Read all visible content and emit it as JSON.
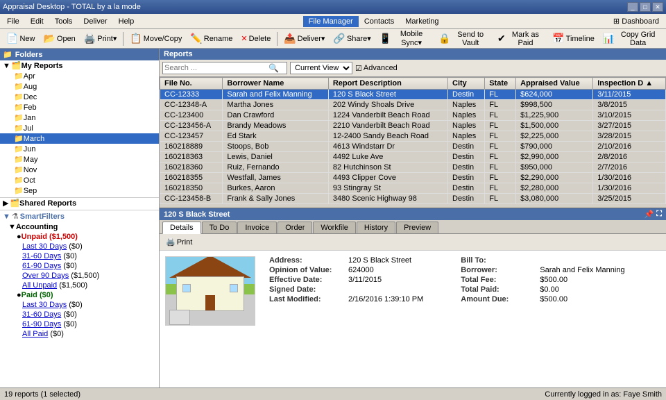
{
  "titleBar": {
    "title": "Appraisal Desktop - TOTAL by a la mode",
    "controls": [
      "_",
      "□",
      "✕"
    ]
  },
  "menuBar": {
    "items": [
      "File",
      "Edit",
      "Tools",
      "Deliver",
      "Help",
      "File Manager",
      "Contacts",
      "Marketing"
    ],
    "active": "File Manager"
  },
  "toolbar": {
    "buttons": [
      {
        "label": "New",
        "icon": "📄"
      },
      {
        "label": "Open",
        "icon": "📂"
      },
      {
        "label": "Print",
        "icon": "🖨️"
      },
      {
        "label": "Move/Copy",
        "icon": "📋"
      },
      {
        "label": "Rename",
        "icon": "✏️"
      },
      {
        "label": "Delete",
        "icon": "✕"
      },
      {
        "label": "Deliver",
        "icon": "📤"
      },
      {
        "label": "Share",
        "icon": "🔗"
      },
      {
        "label": "Mobile Sync",
        "icon": "📱"
      },
      {
        "label": "Send to Vault",
        "icon": "🔒"
      },
      {
        "label": "Mark as Paid",
        "icon": "✔"
      },
      {
        "label": "Timeline",
        "icon": "📅"
      },
      {
        "label": "Copy Grid Data",
        "icon": "📊"
      }
    ],
    "dashboard_label": "Dashboard"
  },
  "sidebar": {
    "header": "Folders",
    "myReports": {
      "label": "My Reports",
      "items": [
        "Apr",
        "Aug",
        "Dec",
        "Feb",
        "Jan",
        "Jul",
        "March",
        "Jun",
        "May",
        "Nov",
        "Oct",
        "Sep"
      ]
    },
    "sharedReports": {
      "label": "Shared Reports"
    },
    "smartFilters": {
      "label": "SmartFilters",
      "accounting": {
        "label": "Accounting",
        "groups": [
          {
            "name": "Unpaid",
            "amount": "($1,500)",
            "items": [
              {
                "label": "Last 30 Days",
                "amount": "($0)"
              },
              {
                "label": "31-60 Days",
                "amount": "($0)"
              },
              {
                "label": "61-90 Days",
                "amount": "($0)"
              },
              {
                "label": "Over 90 Days",
                "amount": "($1,500)"
              },
              {
                "label": "All Unpaid",
                "amount": "($1,500)"
              }
            ]
          },
          {
            "name": "Paid",
            "amount": "($0)",
            "items": [
              {
                "label": "Last 30 Days",
                "amount": "($0)"
              },
              {
                "label": "31-60 Days",
                "amount": "($0)"
              },
              {
                "label": "61-90 Days",
                "amount": "($0)"
              },
              {
                "label": "All Paid",
                "amount": "($0)"
              }
            ]
          }
        ]
      }
    }
  },
  "reports": {
    "header": "Reports",
    "search": {
      "placeholder": "Search ...",
      "view": "Current View",
      "advanced": "Advanced"
    },
    "columns": [
      "File No.",
      "Borrower Name",
      "Report Description",
      "City",
      "State",
      "Appraised Value",
      "Inspection D ▲"
    ],
    "rows": [
      {
        "fileNo": "CC-12333",
        "borrower": "Sarah and Felix Manning",
        "description": "120 S Black Street",
        "city": "Destin",
        "state": "FL",
        "value": "$624,000",
        "date": "3/11/2015",
        "selected": true
      },
      {
        "fileNo": "CC-12348-A",
        "borrower": "Martha Jones",
        "description": "202 Windy Shoals Drive",
        "city": "Naples",
        "state": "FL",
        "value": "$998,500",
        "date": "3/8/2015"
      },
      {
        "fileNo": "CC-123400",
        "borrower": "Dan Crawford",
        "description": "1224 Vanderbilt Beach Road",
        "city": "Naples",
        "state": "FL",
        "value": "$1,225,900",
        "date": "3/10/2015"
      },
      {
        "fileNo": "CC-123456-A",
        "borrower": "Brandy Meadows",
        "description": "2210 Vanderbilt Beach Road",
        "city": "Naples",
        "state": "FL",
        "value": "$1,500,000",
        "date": "3/27/2015"
      },
      {
        "fileNo": "CC-123457",
        "borrower": "Ed Stark",
        "description": "12-2400 Sandy Beach Road",
        "city": "Naples",
        "state": "FL",
        "value": "$2,225,000",
        "date": "3/28/2015"
      },
      {
        "fileNo": "160218889",
        "borrower": "Stoops, Bob",
        "description": "4613 Windstarr Dr",
        "city": "Destin",
        "state": "FL",
        "value": "$790,000",
        "date": "2/10/2016"
      },
      {
        "fileNo": "160218363",
        "borrower": "Lewis, Daniel",
        "description": "4492 Luke Ave",
        "city": "Destin",
        "state": "FL",
        "value": "$2,990,000",
        "date": "2/8/2016"
      },
      {
        "fileNo": "160218360",
        "borrower": "Ruiz, Fernando",
        "description": "82 Hutchinson St",
        "city": "Destin",
        "state": "FL",
        "value": "$950,000",
        "date": "2/7/2016"
      },
      {
        "fileNo": "160218355",
        "borrower": "Westfall, James",
        "description": "4493 Clipper Cove",
        "city": "Destin",
        "state": "FL",
        "value": "$2,290,000",
        "date": "1/30/2016"
      },
      {
        "fileNo": "160218350",
        "borrower": "Burkes, Aaron",
        "description": "93 Stingray St",
        "city": "Destin",
        "state": "FL",
        "value": "$2,280,000",
        "date": "1/30/2016"
      },
      {
        "fileNo": "CC-123458-B",
        "borrower": "Frank & Sally Jones",
        "description": "3480 Scenic Highway 98",
        "city": "Destin",
        "state": "FL",
        "value": "$3,080,000",
        "date": "3/25/2015"
      }
    ]
  },
  "detail": {
    "header": "120 S Black Street",
    "tabs": [
      "Details",
      "To Do",
      "Invoice",
      "Order",
      "Workfile",
      "History",
      "Preview"
    ],
    "activeTab": "Details",
    "printLabel": "Print",
    "fields": {
      "left": [
        {
          "label": "Address:",
          "value": "120 S Black Street"
        },
        {
          "label": "Opinion of Value:",
          "value": "624000"
        },
        {
          "label": "Effective Date:",
          "value": "3/11/2015"
        },
        {
          "label": "Signed Date:",
          "value": ""
        },
        {
          "label": "Last Modified:",
          "value": "2/16/2016 1:39:10 PM"
        }
      ],
      "right": [
        {
          "label": "Bill To:",
          "value": ""
        },
        {
          "label": "Borrower:",
          "value": "Sarah and Felix Manning"
        },
        {
          "label": "Total Fee:",
          "value": "$500.00"
        },
        {
          "label": "Total Paid:",
          "value": "$0.00"
        },
        {
          "label": "Amount Due:",
          "value": "$500.00"
        }
      ]
    }
  },
  "statusBar": {
    "left": "19 reports (1 selected)",
    "right": "Currently logged in as: Faye Smith"
  }
}
